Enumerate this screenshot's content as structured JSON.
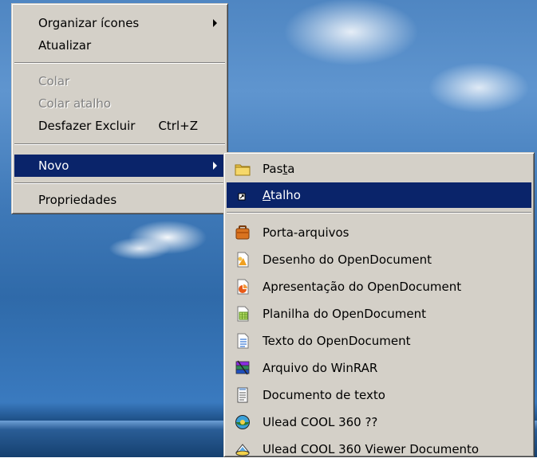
{
  "context_menu": {
    "items": [
      {
        "label": "Organizar ícones",
        "has_submenu": true
      },
      {
        "label": "Atualizar"
      },
      {
        "label": "Colar",
        "disabled": true
      },
      {
        "label": "Colar atalho",
        "disabled": true
      },
      {
        "label": "Desfazer Excluir",
        "shortcut": "Ctrl+Z"
      },
      {
        "label": "Novo",
        "has_submenu": true,
        "selected": true
      },
      {
        "label": "Propriedades"
      }
    ]
  },
  "submenu_novo": {
    "items": [
      {
        "pre": "Pas",
        "ul": "t",
        "post": "a",
        "icon": "folder-icon"
      },
      {
        "pre": "",
        "ul": "A",
        "post": "talho",
        "icon": "shortcut-icon",
        "selected": true
      },
      {
        "label": "Porta-arquivos",
        "icon": "briefcase-icon"
      },
      {
        "label": "Desenho do OpenDocument",
        "icon": "opendocument-drawing-icon"
      },
      {
        "label": "Apresentação do OpenDocument",
        "icon": "opendocument-presentation-icon"
      },
      {
        "label": "Planilha do OpenDocument",
        "icon": "opendocument-spreadsheet-icon"
      },
      {
        "label": "Texto do OpenDocument",
        "icon": "opendocument-text-icon"
      },
      {
        "label": "Arquivo do WinRAR",
        "icon": "winrar-archive-icon"
      },
      {
        "label": "Documento de texto",
        "icon": "text-document-icon"
      },
      {
        "label": "Ulead COOL 360 ??",
        "icon": "ulead-cool360-icon"
      },
      {
        "label": "Ulead COOL 360 Viewer Documento",
        "icon": "ulead-viewer-icon"
      }
    ]
  },
  "colors": {
    "menu_bg": "#d4d0c8",
    "highlight": "#0a246a",
    "disabled_text": "#808080"
  }
}
